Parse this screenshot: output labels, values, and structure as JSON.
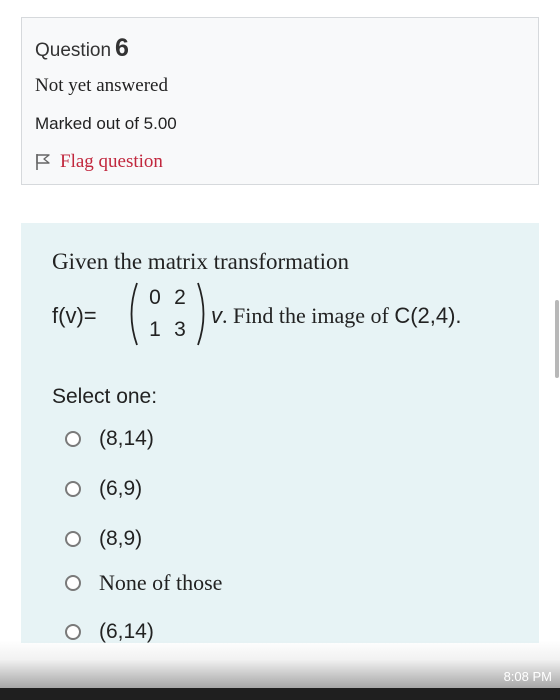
{
  "question_info": {
    "label": "Question",
    "number": "6",
    "state": "Not yet answered",
    "marks": "Marked out of 5.00",
    "flag_label": "Flag question"
  },
  "question": {
    "intro": "Given the matrix transformation",
    "function": "f(v)=",
    "matrix": [
      [
        "0",
        "2"
      ],
      [
        "1",
        "3"
      ]
    ],
    "vector": "v",
    "prompt": ". Find the image of",
    "point": "C(2,4)."
  },
  "answer": {
    "select_label": "Select one:",
    "options": [
      "(8,14)",
      "(6,9)",
      "(8,9)",
      "None of those",
      "(6,14)"
    ]
  },
  "status": {
    "time": "8:08 PM"
  },
  "colors": {
    "flag": "#c1273d",
    "question_bg": "#e7f3f5",
    "info_bg": "#f8f9fa"
  }
}
